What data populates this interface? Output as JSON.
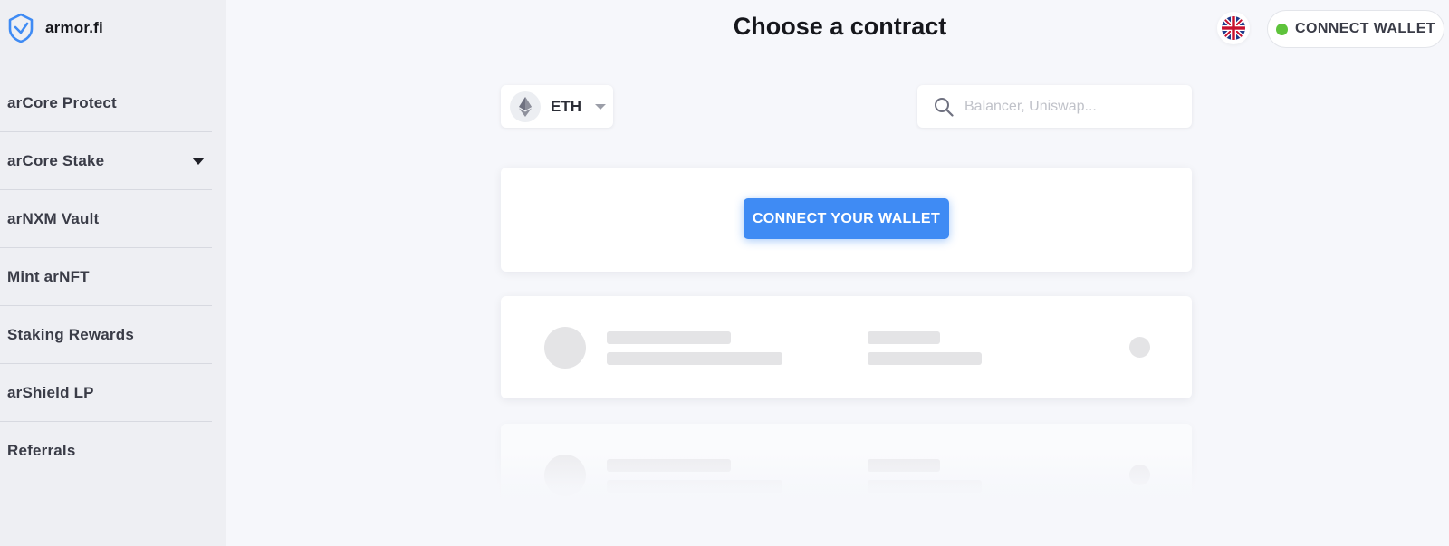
{
  "brand": {
    "name": "armor.fi",
    "icon": "shield-check-icon",
    "accent": "#3f8bf4"
  },
  "sidebar": {
    "items": [
      {
        "label": "arCore Protect",
        "has_dropdown": false
      },
      {
        "label": "arCore Stake",
        "has_dropdown": true
      },
      {
        "label": "arNXM Vault",
        "has_dropdown": false
      },
      {
        "label": "Mint arNFT",
        "has_dropdown": false
      },
      {
        "label": "Staking Rewards",
        "has_dropdown": false
      },
      {
        "label": "arShield LP",
        "has_dropdown": false
      },
      {
        "label": "Referrals",
        "has_dropdown": false
      }
    ]
  },
  "header": {
    "title": "Choose a contract",
    "language_icon": "uk-flag-icon",
    "connect_wallet_label": "CONNECT WALLET",
    "wallet_status_color": "#5ec33b"
  },
  "controls": {
    "network": {
      "selected": "ETH",
      "icon": "ethereum-icon"
    },
    "search": {
      "placeholder": "Balancer, Uniswap...",
      "value": "",
      "icon": "search-icon"
    }
  },
  "main": {
    "connect_cta_label": "CONNECT YOUR WALLET",
    "cta_color": "#3f8bf4",
    "loading_placeholders": 2
  }
}
